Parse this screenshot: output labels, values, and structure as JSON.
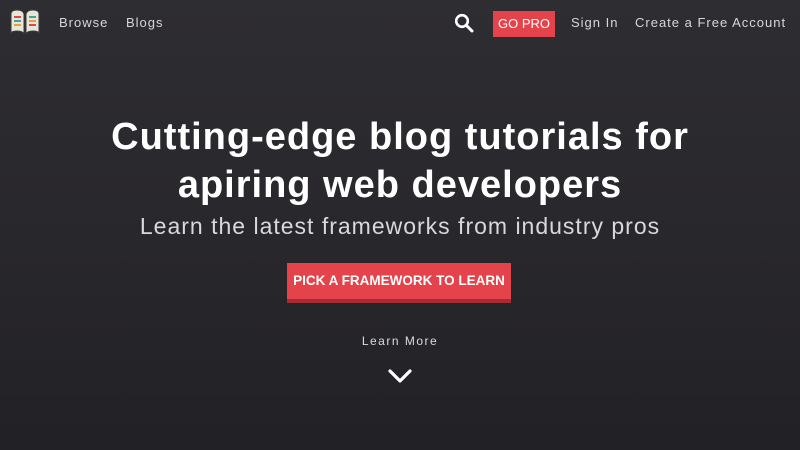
{
  "nav": {
    "logo_icon": "book-icon",
    "browse": "Browse",
    "blogs": "Blogs",
    "search_icon": "search-icon",
    "go_pro": "GO PRO",
    "sign_in": "Sign In",
    "create_account": "Create a Free Account"
  },
  "hero": {
    "title_line1": "Cutting-edge blog tutorials for",
    "title_line2": "apiring web developers",
    "subtitle": "Learn the latest frameworks from industry pros",
    "cta": "PICK A FRAMEWORK TO LEARN",
    "learn_more": "Learn More",
    "chevron_icon": "chevron-down-icon"
  },
  "colors": {
    "accent": "#e5434b",
    "accent_shadow": "#a82b32",
    "background": "#2b2a2e",
    "text": "#ffffff"
  }
}
